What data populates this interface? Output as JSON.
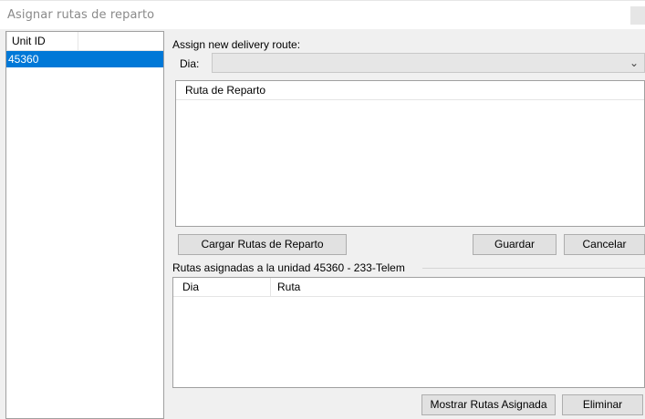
{
  "window": {
    "title": "Asignar rutas de reparto"
  },
  "units_list": {
    "header": "Unit ID",
    "rows": [
      "45360"
    ]
  },
  "assign": {
    "label": "Assign new delivery route:",
    "dia_label": "Dia:",
    "dia_value": "",
    "routes_header": "Ruta de Reparto"
  },
  "buttons": {
    "cargar": "Cargar Rutas de Reparto",
    "guardar": "Guardar",
    "cancelar": "Cancelar",
    "mostrar": "Mostrar Rutas Asignada",
    "eliminar": "Eliminar"
  },
  "assigned": {
    "group_label": "Rutas asignadas a la unidad 45360 - 233-Telem",
    "columns": [
      "Dia",
      "Ruta"
    ]
  },
  "colors": {
    "selection": "#0078d7",
    "background": "#f0f0f0"
  }
}
